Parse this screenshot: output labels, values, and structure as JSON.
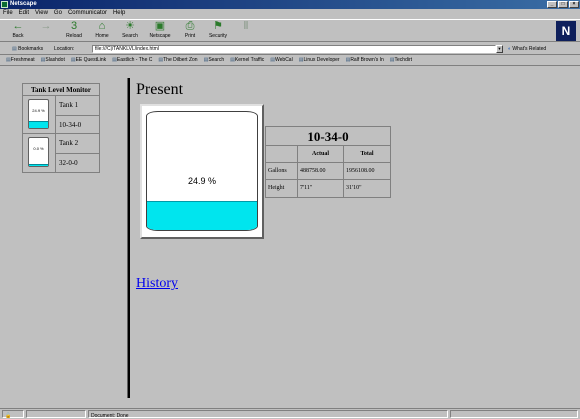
{
  "window": {
    "title": "Netscape"
  },
  "menu": [
    "File",
    "Edit",
    "View",
    "Go",
    "Communicator",
    "Help"
  ],
  "toolbar": {
    "buttons": [
      {
        "label": "Back",
        "icon": "back-arrow-icon",
        "glyph": "←"
      },
      {
        "label": "Forward",
        "icon": "forward-arrow-icon",
        "glyph": "→"
      },
      {
        "label": "Reload",
        "icon": "reload-icon",
        "glyph": "3"
      },
      {
        "label": "Home",
        "icon": "home-icon",
        "glyph": "⌂"
      },
      {
        "label": "Search",
        "icon": "search-icon",
        "glyph": "☀"
      },
      {
        "label": "Netscape",
        "icon": "netscape-icon",
        "glyph": "▣"
      },
      {
        "label": "Print",
        "icon": "print-icon",
        "glyph": "⎙"
      },
      {
        "label": "Security",
        "icon": "security-icon",
        "glyph": "⚑"
      },
      {
        "label": "",
        "icon": "stop-icon",
        "glyph": "Ⅱ"
      }
    ],
    "logo": "N"
  },
  "location": {
    "bookmarks_label": "Bookmarks",
    "location_label": "Location:",
    "url": "file:///C|/TANKLVL/index.html",
    "whats_related": "What's Related"
  },
  "personal_toolbar": [
    "Freshmeat",
    "Slashdot",
    "EE QuestLink",
    "Eastlich - The C",
    "The Dilbert Zon",
    "Search",
    "Kernel Traffic",
    "WebCal",
    "Linux Developer",
    "Ralf Brown's In",
    "Techdirt"
  ],
  "tanks_table": {
    "title": "Tank Level Monitor",
    "tanks": [
      {
        "name": "Tank 1",
        "code": "10-34-0",
        "level_text": "24.9 %",
        "level": 0.249
      },
      {
        "name": "Tank 2",
        "code": "32-0-0",
        "level_text": "0.0 %",
        "level": 0.0
      }
    ]
  },
  "present": {
    "heading": "Present",
    "level_text": "24.9 %",
    "level": 0.249,
    "table": {
      "title": "10-34-0",
      "headers": [
        "",
        "Actual",
        "Total"
      ],
      "rows": [
        [
          "Gallons",
          "488758.00",
          "1956108.00"
        ],
        [
          "Height",
          "7'11\"",
          "31'10\""
        ]
      ]
    },
    "history_link": "History"
  },
  "status": {
    "text": "Document: Done"
  },
  "colors": {
    "liquid": "#00e5ee",
    "title_bar": "#0a246a",
    "link": "#0000ee"
  }
}
